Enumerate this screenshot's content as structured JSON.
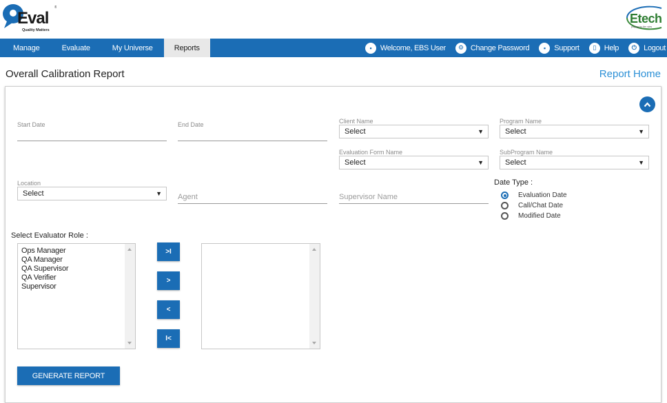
{
  "brand": {
    "logo_text": "QEval",
    "logo_tagline": "Quality Matters",
    "partner_logo_text": "Etech",
    "partner_tagline": "playing by the rules",
    "accent_color": "#1b6db5",
    "link_color": "#2a8fd6"
  },
  "nav": {
    "items": [
      {
        "label": "Manage",
        "active": false
      },
      {
        "label": "Evaluate",
        "active": false
      },
      {
        "label": "My Universe",
        "active": false
      },
      {
        "label": "Reports",
        "active": true
      }
    ],
    "right": [
      {
        "icon": "user-badge-icon",
        "label": "Welcome, EBS User"
      },
      {
        "icon": "gear-icon",
        "label": "Change Password"
      },
      {
        "icon": "support-icon",
        "label": "Support"
      },
      {
        "icon": "book-icon",
        "label": "Help"
      },
      {
        "icon": "power-icon",
        "label": "Logout"
      }
    ]
  },
  "page": {
    "title": "Overall Calibration Report",
    "report_home": "Report Home"
  },
  "form": {
    "start_date": {
      "label": "Start Date",
      "value": ""
    },
    "end_date": {
      "label": "End Date",
      "value": ""
    },
    "client_name": {
      "label": "Client Name",
      "value": "Select"
    },
    "program_name": {
      "label": "Program Name",
      "value": "Select"
    },
    "evaluation_form_name": {
      "label": "Evaluation Form Name",
      "value": "Select"
    },
    "subprogram_name": {
      "label": "SubProgram Name",
      "value": "Select"
    },
    "location": {
      "label": "Location",
      "value": "Select"
    },
    "agent": {
      "placeholder": "Agent",
      "value": ""
    },
    "supervisor_name": {
      "placeholder": "Supervisor Name",
      "value": ""
    },
    "date_type": {
      "label": "Date Type :",
      "options": [
        {
          "label": "Evaluation Date",
          "selected": true
        },
        {
          "label": "Call/Chat Date",
          "selected": false
        },
        {
          "label": "Modified Date",
          "selected": false
        }
      ]
    },
    "evaluator_role": {
      "label": "Select Evaluator Role :",
      "available": [
        "Ops Manager",
        "QA Manager",
        "QA Supervisor",
        "QA Verifier",
        "Supervisor"
      ],
      "selected": [],
      "buttons": {
        "move_all_right": ">I",
        "move_right": ">",
        "move_left": "<",
        "move_all_left": "I<"
      }
    },
    "generate_label": "GENERATE REPORT"
  }
}
